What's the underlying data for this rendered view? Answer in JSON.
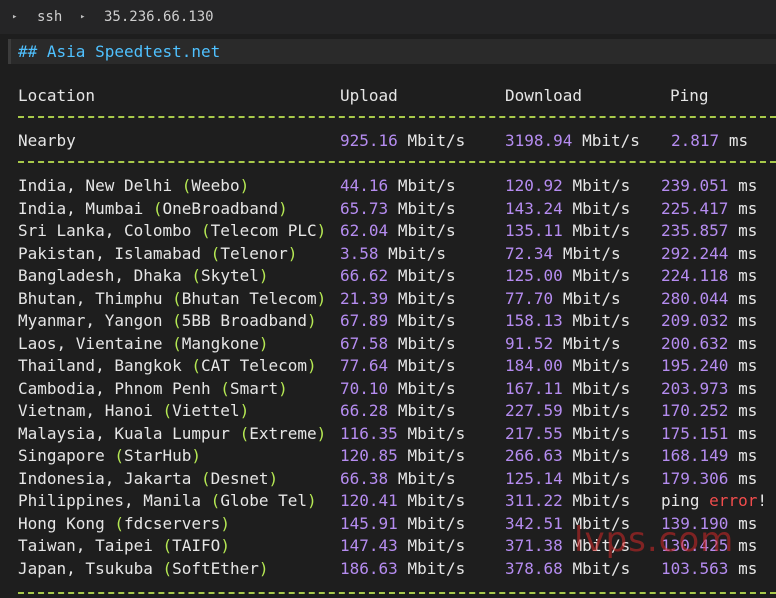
{
  "breadcrumb": {
    "items": [
      "ssh",
      "35.236.66.130"
    ]
  },
  "heading": "## Asia Speedtest.net",
  "table": {
    "headers": {
      "location": "Location",
      "upload": "Upload",
      "download": "Download",
      "ping": "Ping"
    },
    "nearby": {
      "location": "Nearby",
      "upload": "925.16",
      "upload_unit": "Mbit/s",
      "download": "3198.94",
      "download_unit": "Mbit/s",
      "ping": "2.817",
      "ping_unit": "ms"
    },
    "rows": [
      {
        "place": "India, New Delhi",
        "isp": "Weebo",
        "upload": "44.16",
        "download": "120.92",
        "ping": "239.051"
      },
      {
        "place": "India, Mumbai",
        "isp": "OneBroadband",
        "upload": "65.73",
        "download": "143.24",
        "ping": "225.417"
      },
      {
        "place": "Sri Lanka, Colombo",
        "isp": "Telecom PLC",
        "upload": "62.04",
        "download": "135.11",
        "ping": "235.857"
      },
      {
        "place": "Pakistan, Islamabad",
        "isp": "Telenor",
        "upload": "3.58",
        "download": "72.34",
        "ping": "292.244"
      },
      {
        "place": "Bangladesh, Dhaka",
        "isp": "Skytel",
        "upload": "66.62",
        "download": "125.00",
        "ping": "224.118"
      },
      {
        "place": "Bhutan, Thimphu",
        "isp": "Bhutan Telecom",
        "upload": "21.39",
        "download": "77.70",
        "ping": "280.044"
      },
      {
        "place": "Myanmar, Yangon",
        "isp": "5BB Broadband",
        "upload": "67.89",
        "download": "158.13",
        "ping": "209.032"
      },
      {
        "place": "Laos, Vientaine",
        "isp": "Mangkone",
        "upload": "67.58",
        "download": "91.52",
        "ping": "200.632"
      },
      {
        "place": "Thailand, Bangkok",
        "isp": "CAT Telecom",
        "upload": "77.64",
        "download": "184.00",
        "ping": "195.240"
      },
      {
        "place": "Cambodia, Phnom Penh",
        "isp": "Smart",
        "upload": "70.10",
        "download": "167.11",
        "ping": "203.973"
      },
      {
        "place": "Vietnam, Hanoi",
        "isp": "Viettel",
        "upload": "66.28",
        "download": "227.59",
        "ping": "170.252"
      },
      {
        "place": "Malaysia, Kuala Lumpur",
        "isp": "Extreme",
        "upload": "116.35",
        "download": "217.55",
        "ping": "175.151"
      },
      {
        "place": "Singapore",
        "isp": "StarHub",
        "upload": "120.85",
        "download": "266.63",
        "ping": "168.149"
      },
      {
        "place": "Indonesia, Jakarta",
        "isp": "Desnet",
        "upload": "66.38",
        "download": "125.14",
        "ping": "179.306"
      },
      {
        "place": "Philippines, Manila",
        "isp": "Globe Tel",
        "upload": "120.41",
        "download": "311.22",
        "ping": null,
        "ping_word": "ping",
        "ping_error": "error",
        "ping_bang": "!"
      },
      {
        "place": "Hong Kong",
        "isp": "fdcservers",
        "upload": "145.91",
        "download": "342.51",
        "ping": "139.190"
      },
      {
        "place": "Taiwan, Taipei",
        "isp": "TAIFO",
        "upload": "147.43",
        "download": "371.38",
        "ping": "130.425"
      },
      {
        "place": "Japan, Tsukuba",
        "isp": "SoftEther",
        "upload": "186.63",
        "download": "378.68",
        "ping": "103.563"
      }
    ],
    "unit_speed": "Mbit/s",
    "unit_ping": "ms"
  },
  "watermark": "lvps.com",
  "colors": {
    "background": "#1e1e1e",
    "heading": "#4fc1ff",
    "number": "#b58cf0",
    "parenthesis": "#b5e853",
    "dashes": "#a8c94a",
    "error": "#f14c4c"
  },
  "icons": {
    "breadcrumb_separator": "chevron-right-icon"
  }
}
